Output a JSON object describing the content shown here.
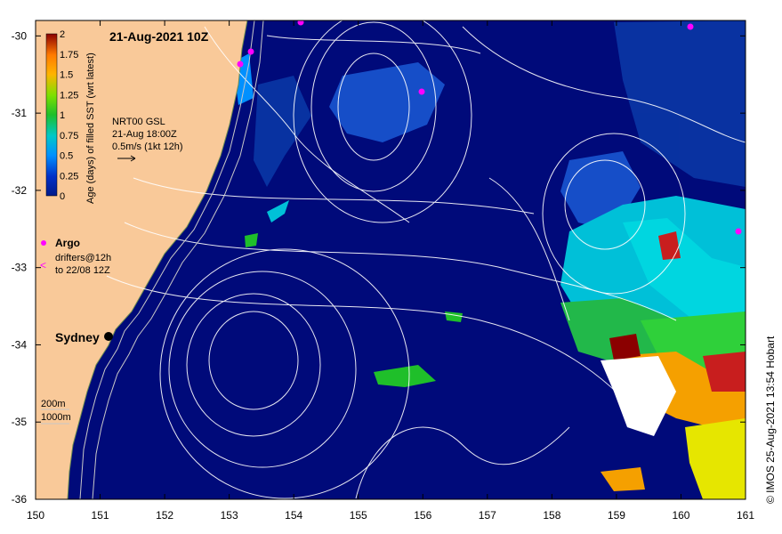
{
  "map": {
    "title": "21-Aug-2021 10Z",
    "x_ticks": [
      "150",
      "151",
      "152",
      "153",
      "154",
      "155",
      "156",
      "157",
      "158",
      "159",
      "160",
      "161"
    ],
    "y_ticks": [
      "-30",
      "-31",
      "-32",
      "-33",
      "-34",
      "-35",
      "-36"
    ],
    "lon_range": [
      150,
      161
    ],
    "lat_range": [
      -36,
      -29.8
    ],
    "colorbar": {
      "label": "Age (days) of filled SST (wrt latest)",
      "ticks": [
        "2",
        "1.75",
        "1.5",
        "1.25",
        "1",
        "0.75",
        "0.5",
        "0.25",
        "0"
      ],
      "colors": [
        "#8b0000",
        "#c81e1e",
        "#ff7a00",
        "#ffb400",
        "#e8e800",
        "#7de000",
        "#1fbf2a",
        "#00c8c8",
        "#0090ff",
        "#0030c8",
        "#001a8a"
      ]
    },
    "vector_note": {
      "line1": "NRT00 GSL",
      "line2": "21-Aug 18:00Z",
      "line3": "0.5m/s (1kt 12h)"
    },
    "legend": {
      "argo": "Argo",
      "drifters_line1": "drifters@12h",
      "drifters_line2": "to 22/08 12Z"
    },
    "city": "Sydney",
    "bathymetry": {
      "line1": "200m",
      "line2": "1000m"
    },
    "credit": "© IMOS 25-Aug-2021 13:54 Hobart",
    "colors": {
      "land": "#f9c999",
      "ocean_deep": "#000a7a",
      "ocean_mid": "#0a2e9e",
      "contour": "#ffffff",
      "argo": "#ff00ff"
    }
  }
}
